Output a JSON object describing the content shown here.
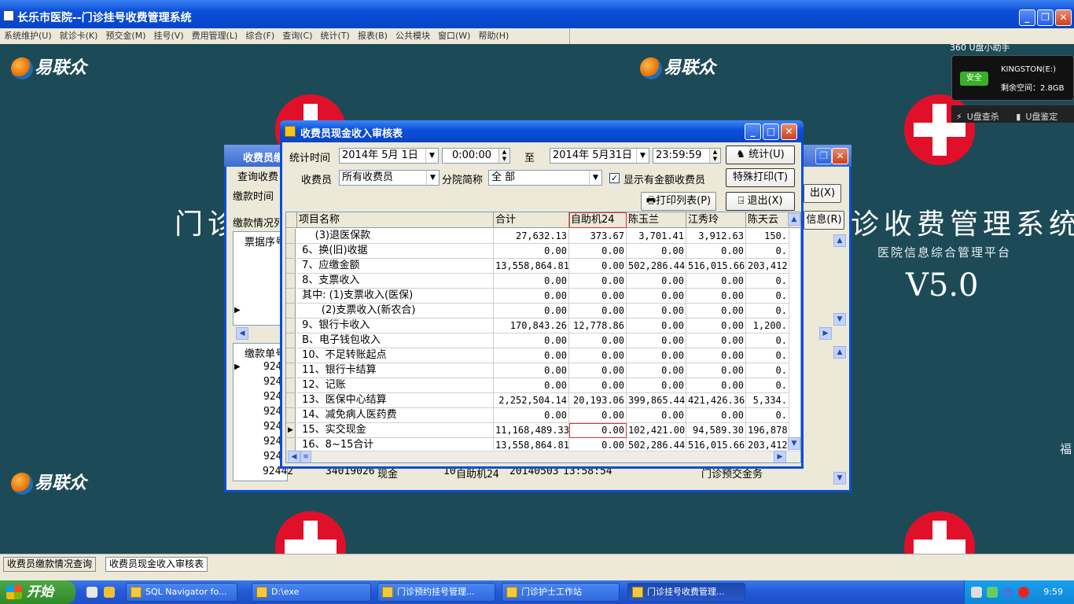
{
  "app": {
    "title": "长乐市医院--门诊挂号收费管理系统"
  },
  "menu": [
    "系统维护(U)",
    "就诊卡(K)",
    "预交金(M)",
    "挂号(V)",
    "费用管理(L)",
    "综合(F)",
    "查询(C)",
    "统计(T)",
    "报表(B)",
    "公共模块",
    "窗口(W)",
    "帮助(H)"
  ],
  "desktop": {
    "logo": "易联众",
    "title_fragment_left": "门诊",
    "title_fragment_right": "诊收费管理系统",
    "subtitle": "医院信息综合管理平台",
    "version": "V5.0",
    "side_char": "福"
  },
  "usb_widget": {
    "header": "360 U盘小助手",
    "safe": "安全",
    "device": "KINGSTON(E:)",
    "free": "剩余空间：2.8GB",
    "scan": "U盘查杀",
    "check": "U盘鉴定"
  },
  "bg_window": {
    "title": "收费员缴",
    "query_tab": "查询收费",
    "pay_time_label": "缴款时间",
    "pay_status": "缴款情况列",
    "exit_label": "出(X)",
    "info_label": "信息(R)",
    "col_receipt": "票据序号",
    "col_bill": "缴款单号",
    "bill_rows": [
      "9244",
      "9244",
      "9244",
      "9244",
      "9244",
      "9244",
      "9244"
    ],
    "last_row": {
      "no": "92442",
      "code": "34019026",
      "type": "现金",
      "count": "10",
      "machine": "自助机24",
      "date": "20140503",
      "time": "13:58:54",
      "note": "门诊预交金务"
    }
  },
  "dialog": {
    "title": "收费员现金收入审核表",
    "stat_time_label": "统计时间",
    "date_from": "2014年 5月 1日",
    "time_from": "0:00:00",
    "to_label": "至",
    "date_to": "2014年 5月31日",
    "time_to": "23:59:59",
    "stat_button": "统计(U)",
    "cashier_label": "收费员",
    "cashier_value": "所有收费员",
    "branch_label": "分院简称",
    "branch_value": "全 部",
    "show_nonzero_label": "显示有金额收费员",
    "show_nonzero_checked": true,
    "special_print_button": "特殊打印(T)",
    "print_list_button": "打印列表(P)",
    "exit_button": "退出(X)",
    "columns": [
      "项目名称",
      "合计",
      "自助机24",
      "陈玉兰",
      "江秀玲",
      "陈天云"
    ],
    "rows": [
      {
        "name": "     (3)退医保款",
        "cells": [
          "27,632.13",
          "373.67",
          "3,701.41",
          "3,912.63",
          "150."
        ]
      },
      {
        "name": " 6、换(旧)收据",
        "cells": [
          "0.00",
          "0.00",
          "0.00",
          "0.00",
          "0."
        ]
      },
      {
        "name": " 7、应缴金额",
        "cells": [
          "13,558,864.81",
          "0.00",
          "502,286.44",
          "516,015.66",
          "203,412."
        ]
      },
      {
        "name": " 8、支票收入",
        "cells": [
          "0.00",
          "0.00",
          "0.00",
          "0.00",
          "0."
        ]
      },
      {
        "name": " 其中: (1)支票收入(医保)",
        "cells": [
          "0.00",
          "0.00",
          "0.00",
          "0.00",
          "0."
        ]
      },
      {
        "name": "       (2)支票收入(新农合)",
        "cells": [
          "0.00",
          "0.00",
          "0.00",
          "0.00",
          "0."
        ]
      },
      {
        "name": " 9、银行卡收入",
        "cells": [
          "170,843.26",
          "12,778.86",
          "0.00",
          "0.00",
          "1,200."
        ]
      },
      {
        "name": " B、电子钱包收入",
        "cells": [
          "0.00",
          "0.00",
          "0.00",
          "0.00",
          "0."
        ]
      },
      {
        "name": " 10、不足转账起点",
        "cells": [
          "0.00",
          "0.00",
          "0.00",
          "0.00",
          "0."
        ]
      },
      {
        "name": " 11、银行卡结算",
        "cells": [
          "0.00",
          "0.00",
          "0.00",
          "0.00",
          "0."
        ]
      },
      {
        "name": " 12、记账",
        "cells": [
          "0.00",
          "0.00",
          "0.00",
          "0.00",
          "0."
        ]
      },
      {
        "name": " 13、医保中心结算",
        "cells": [
          "2,252,504.14",
          "20,193.06",
          "399,865.44",
          "421,426.36",
          "5,334."
        ]
      },
      {
        "name": " 14、减免病人医药费",
        "cells": [
          "0.00",
          "0.00",
          "0.00",
          "0.00",
          "0."
        ]
      },
      {
        "name": " 15、实交现金",
        "cells": [
          "11,168,489.33",
          "0.00",
          "102,421.00",
          "94,589.30",
          "196,878."
        ]
      },
      {
        "name": " 16、8~15合计",
        "cells": [
          "13,558,864.81",
          "0.00",
          "502,286.44",
          "516,015.66",
          "203,412."
        ]
      }
    ]
  },
  "status_tabs": [
    "收费员缴款情况查询",
    "收费员现金收入审核表"
  ],
  "taskbar": {
    "start": "开始",
    "tasks": [
      "SQL Navigator fo...",
      "D:\\exe",
      "门诊预约挂号管理...",
      "门诊护士工作站",
      "门诊挂号收费管理..."
    ],
    "clock": "9:59"
  },
  "colors": {
    "titlebar": "#0a4ed8",
    "desktop": "#1d4a57",
    "highlight": "#e03030"
  }
}
